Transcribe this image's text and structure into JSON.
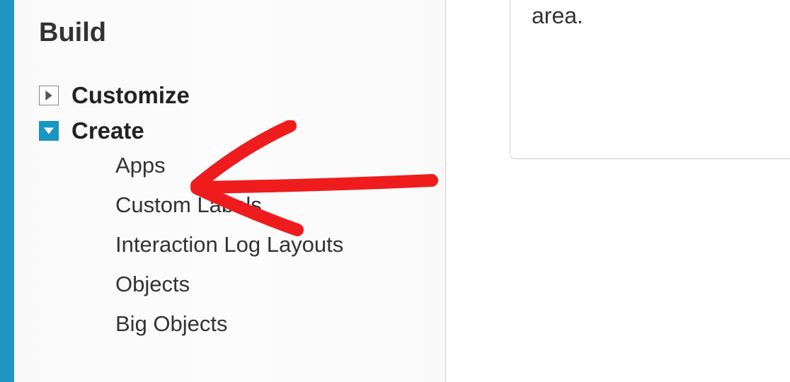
{
  "sidebar": {
    "section_title": "Build",
    "items": [
      {
        "label": "Customize",
        "expanded": false
      },
      {
        "label": "Create",
        "expanded": true
      }
    ],
    "create_subitems": [
      {
        "label": "Apps"
      },
      {
        "label": "Custom Labels"
      },
      {
        "label": "Interaction Log Layouts"
      },
      {
        "label": "Objects"
      },
      {
        "label": "Big Objects"
      }
    ]
  },
  "content": {
    "visible_text": "area."
  },
  "annotation": {
    "type": "arrow",
    "color": "#ee1c1c",
    "points_to": "Apps"
  }
}
